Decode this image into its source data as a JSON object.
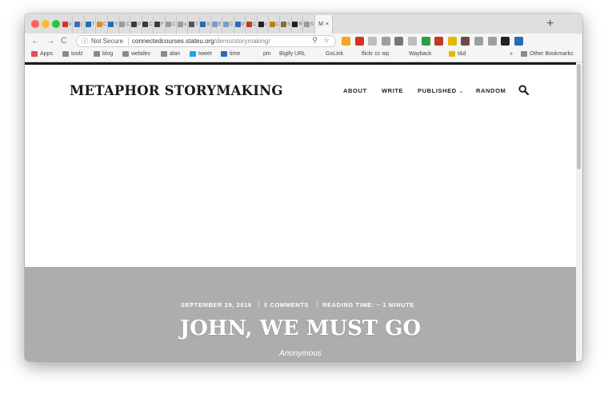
{
  "browser": {
    "tabs": [
      {
        "letter": "Ir",
        "color": "#d93025"
      },
      {
        "letter": "(",
        "color": "#3b6fb6"
      },
      {
        "letter": "T",
        "color": "#1d6fb8"
      },
      {
        "letter": "C",
        "color": "#e08a1e"
      },
      {
        "letter": "Y",
        "color": "#2a6bb8"
      },
      {
        "letter": "C",
        "color": "#9a9a9a"
      },
      {
        "letter": "P",
        "color": "#3a3a3a"
      },
      {
        "letter": "C",
        "color": "#3a3a3a"
      },
      {
        "letter": "F",
        "color": "#3a3a3a"
      },
      {
        "letter": "C",
        "color": "#9a9a9a"
      },
      {
        "letter": "s",
        "color": "#9a9a9a"
      },
      {
        "letter": "T",
        "color": "#555555"
      },
      {
        "letter": "S",
        "color": "#2a6bb8"
      },
      {
        "letter": "E",
        "color": "#7a9bc8"
      },
      {
        "letter": "C",
        "color": "#7a9bc8"
      },
      {
        "letter": "V",
        "color": "#2a6bb8"
      },
      {
        "letter": "C",
        "color": "#c0392b"
      },
      {
        "letter": "c",
        "color": "#222222"
      },
      {
        "letter": "C",
        "color": "#b8860b"
      },
      {
        "letter": "S",
        "color": "#8b6b3d"
      },
      {
        "letter": "R",
        "color": "#222222"
      },
      {
        "letter": "S",
        "color": "#9a9a9a"
      }
    ],
    "active_tab": {
      "letter": "M",
      "close": "×"
    },
    "new_tab": "+",
    "nav": {
      "back": "←",
      "forward": "→",
      "reload": "C"
    },
    "address": {
      "security": "Not Secure",
      "host": "connectedcourses.stateu.org",
      "path": "/demo/storymaking/"
    },
    "extension_colors": [
      "#f5a623",
      "#d93025",
      "#bdbdbd",
      "#9e9e9e",
      "#777777",
      "#bdbdbd",
      "#2e9e3f",
      "#c0392b",
      "#e6b800",
      "#6d4c41",
      "#9e9e9e",
      "#9e9e9e",
      "#222222",
      "#2a6bb8"
    ],
    "bookmarks": [
      {
        "label": "Apps",
        "kind": "apps"
      },
      {
        "label": "toolz",
        "kind": "folder"
      },
      {
        "label": "blog",
        "kind": "folder"
      },
      {
        "label": "webdev",
        "kind": "folder"
      },
      {
        "label": "alan",
        "kind": "folder"
      },
      {
        "label": "tweet",
        "kind": "twitter"
      },
      {
        "label": "time",
        "kind": "blue"
      },
      {
        "label": "pin",
        "kind": "page"
      },
      {
        "label": "Bigify URL",
        "kind": "page"
      },
      {
        "label": "GoLink",
        "kind": "page"
      },
      {
        "label": "flickr cc wp",
        "kind": "page"
      },
      {
        "label": "Wayback",
        "kind": "page"
      },
      {
        "label": "t&d",
        "kind": "dots"
      }
    ],
    "bookmarks_overflow": "»",
    "other_bookmarks": "Other Bookmarks"
  },
  "site": {
    "title": "METAPHOR STORYMAKING",
    "nav": [
      "ABOUT",
      "WRITE",
      "PUBLISHED",
      "RANDOM"
    ],
    "dropdown_indicator": "⌄"
  },
  "post": {
    "date": "SEPTEMBER 29, 2016",
    "comments": "0 COMMENTS",
    "reading_time": "READING TIME: ~ 1 MINUTE",
    "title": "JOHN, WE MUST GO",
    "author": "Anonymous",
    "hero_color": "#adadad"
  }
}
